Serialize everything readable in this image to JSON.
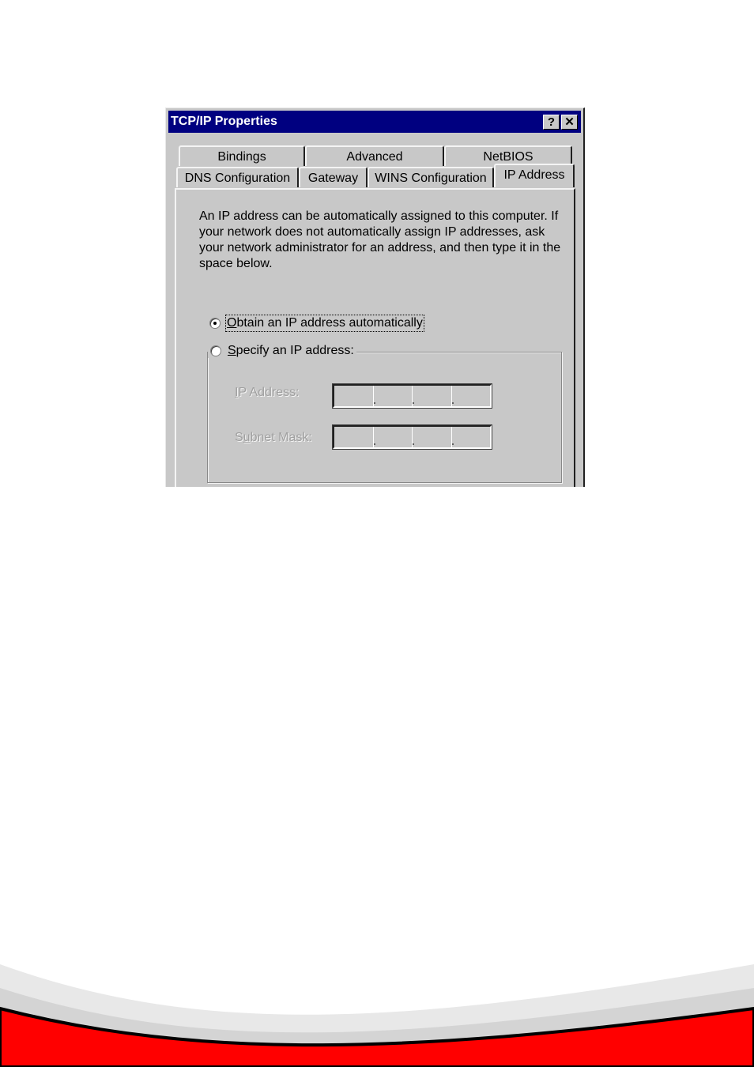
{
  "dialog": {
    "title": "TCP/IP Properties",
    "help_button": "?",
    "close_button": "✕"
  },
  "tabs_back_row": [
    {
      "label": "Bindings"
    },
    {
      "label": "Advanced"
    },
    {
      "label": "NetBIOS"
    }
  ],
  "tabs_front_row": [
    {
      "label": "DNS Configuration"
    },
    {
      "label": "Gateway"
    },
    {
      "label": "WINS Configuration"
    },
    {
      "label": "IP Address",
      "active": true
    }
  ],
  "panel": {
    "description": "An IP address can be automatically assigned to this computer. If your network does not automatically assign IP addresses, ask your network administrator for an address, and then type it in the space below.",
    "obtain_auto": {
      "mnemonic": "O",
      "rest": "btain an IP address automatically",
      "selected": true
    },
    "specify": {
      "mnemonic": "S",
      "rest": "pecify an IP address:",
      "selected": false
    },
    "ip_address_label": {
      "mnemonic": "I",
      "rest": "P Address:"
    },
    "subnet_mask_label": {
      "pre": "S",
      "mnemonic": "u",
      "rest": "bnet Mask:"
    },
    "ip_address_value": [
      "",
      "",
      "",
      ""
    ],
    "subnet_mask_value": [
      "",
      "",
      "",
      ""
    ]
  },
  "colors": {
    "titlebar": "#000080",
    "face": "#c8c8c8",
    "footer_red": "#ff0000"
  }
}
